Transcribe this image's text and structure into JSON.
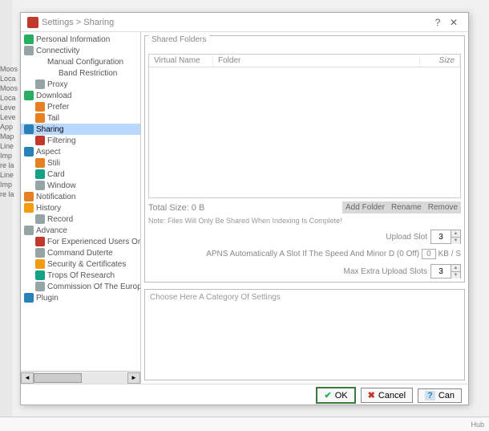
{
  "backdrop_lines": [
    "Moos",
    "Loca",
    "Moos",
    "Loca",
    "Leve",
    "Leve",
    "App",
    "Map",
    "Line",
    "Imp",
    "re la",
    "Line",
    "Imp",
    "re la"
  ],
  "dialog": {
    "title": "Settings > Sharing",
    "help_btn": "?",
    "close_btn": "✕"
  },
  "tree": [
    {
      "label": "Personal Information",
      "icon": "ic-green",
      "level": 0
    },
    {
      "label": "Connectivity",
      "icon": "ic-gray",
      "level": 0
    },
    {
      "label": "Manual Configuration",
      "icon": "",
      "level": 1
    },
    {
      "label": "Band Restriction",
      "icon": "",
      "level": 2
    },
    {
      "label": "Proxy",
      "icon": "ic-gray",
      "level": 1
    },
    {
      "label": "Download",
      "icon": "ic-green",
      "level": 0
    },
    {
      "label": "Prefer",
      "icon": "ic-orange",
      "level": 1
    },
    {
      "label": "Tail",
      "icon": "ic-orange",
      "level": 1
    },
    {
      "label": "Sharing",
      "icon": "ic-blue",
      "level": 0,
      "selected": true
    },
    {
      "label": "Filtering",
      "icon": "ic-red",
      "level": 1
    },
    {
      "label": "Aspect",
      "icon": "ic-blue",
      "level": 0
    },
    {
      "label": "Stili",
      "icon": "ic-orange",
      "level": 1
    },
    {
      "label": "Card",
      "icon": "ic-teal",
      "level": 1
    },
    {
      "label": "Window",
      "icon": "ic-gray",
      "level": 1
    },
    {
      "label": "Notification",
      "icon": "ic-orange",
      "level": 0
    },
    {
      "label": "History",
      "icon": "ic-yellow",
      "level": 0
    },
    {
      "label": "Record",
      "icon": "ic-gray",
      "level": 1
    },
    {
      "label": "Advance",
      "icon": "ic-gray",
      "level": 0
    },
    {
      "label": "For Experienced Users Only",
      "icon": "ic-red",
      "level": 1
    },
    {
      "label": "Command Duterte",
      "icon": "ic-gray",
      "level": 1
    },
    {
      "label": "Security & Certificates",
      "icon": "ic-yellow",
      "level": 1
    },
    {
      "label": "Trops Of Research",
      "icon": "ic-teal",
      "level": 1
    },
    {
      "label": "Commission Of The European Communities",
      "icon": "ic-gray",
      "level": 1
    },
    {
      "label": "Plugin",
      "icon": "ic-blue",
      "level": 0
    }
  ],
  "shared": {
    "group_title": "Shared Folders",
    "col_vname": "Virtual Name",
    "col_folder": "Folder",
    "col_size": "Size",
    "total_label": "Total Size: 0 B",
    "btn_add": "Add Folder",
    "btn_rename": "Rename",
    "btn_remove": "Remove",
    "note": "Note: Files Will Only Be Shared When Indexing Is Complete!",
    "upload_slot_label": "Upload Slot",
    "upload_slot_value": "3",
    "apns_text_1": "APNS Automatically A Slot If The Speed And Minor D (0 Off)",
    "apns_value": "0",
    "apns_text_2": "KB / S",
    "max_extra_label": "Max Extra Upload Slots",
    "max_extra_value": "3"
  },
  "help_text": "Choose Here A Category Of Settings",
  "buttons": {
    "ok": "OK",
    "cancel": "Cancel",
    "help": "Can"
  },
  "status": {
    "hub": "Hub"
  }
}
